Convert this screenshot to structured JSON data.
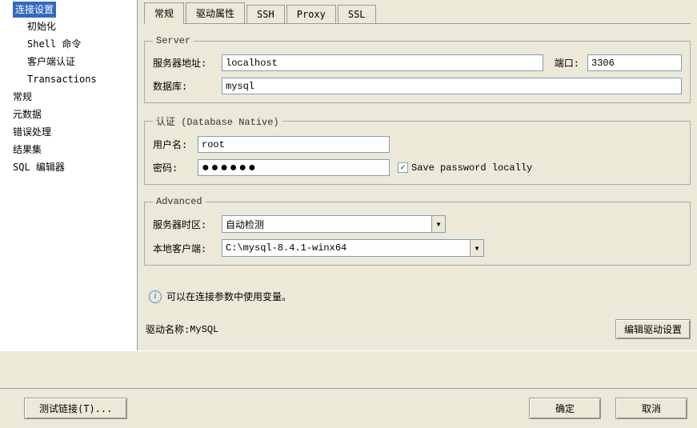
{
  "sidebar": {
    "items": [
      {
        "label": "连接设置",
        "selected": true,
        "child": false
      },
      {
        "label": "初始化",
        "child": true
      },
      {
        "label": "Shell 命令",
        "child": true
      },
      {
        "label": "客户端认证",
        "child": true
      },
      {
        "label": "Transactions",
        "child": true
      },
      {
        "label": "常规",
        "child": false
      },
      {
        "label": "元数据",
        "child": false
      },
      {
        "label": "错误处理",
        "child": false
      },
      {
        "label": "结果集",
        "child": false
      },
      {
        "label": "SQL 编辑器",
        "child": false
      }
    ]
  },
  "tabs": {
    "items": [
      "常规",
      "驱动属性",
      "SSH",
      "Proxy",
      "SSL"
    ],
    "active": 0
  },
  "server": {
    "legend": "Server",
    "host_label": "服务器地址:",
    "host_value": "localhost",
    "port_label": "端口:",
    "port_value": "3306",
    "db_label": "数据库:",
    "db_value": "mysql"
  },
  "auth": {
    "legend": "认证 (Database Native)",
    "user_label": "用户名:",
    "user_value": "root",
    "pass_label": "密码:",
    "pass_value": "●●●●●●",
    "save_label": "Save password locally",
    "save_checked": true
  },
  "advanced": {
    "legend": "Advanced",
    "tz_label": "服务器时区:",
    "tz_value": "自动检测",
    "client_label": "本地客户端:",
    "client_value": "C:\\mysql-8.4.1-winx64"
  },
  "info": {
    "text": "可以在连接参数中使用变量。"
  },
  "driver": {
    "label": "驱动名称: ",
    "value": "MySQL",
    "edit_btn": "编辑驱动设置"
  },
  "buttons": {
    "test": "测试链接(T)...",
    "ok": "确定",
    "cancel": "取消"
  }
}
